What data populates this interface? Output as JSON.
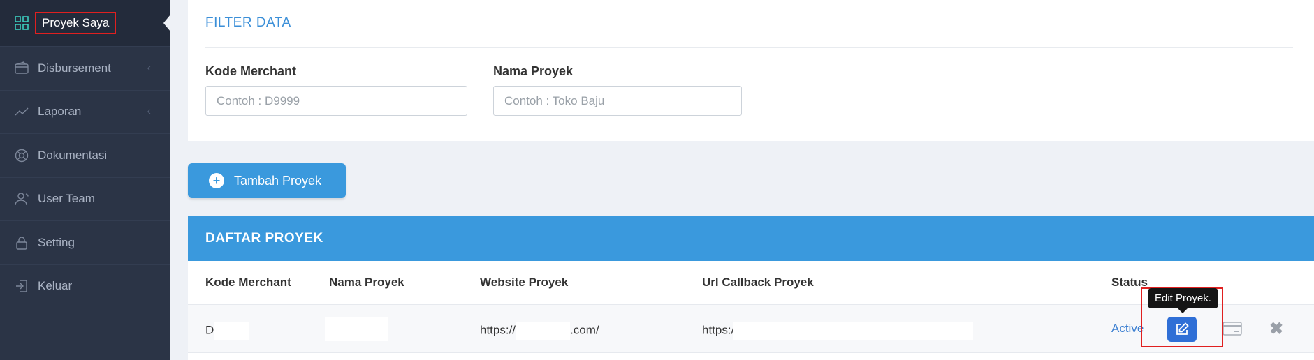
{
  "sidebar": {
    "items": [
      {
        "label": "Proyek Saya",
        "icon": "grid-icon",
        "active": true
      },
      {
        "label": "Disbursement",
        "icon": "wallet-icon",
        "chevron": "‹"
      },
      {
        "label": "Laporan",
        "icon": "chart-line-icon",
        "chevron": "‹"
      },
      {
        "label": "Dokumentasi",
        "icon": "lifebuoy-icon"
      },
      {
        "label": "User Team",
        "icon": "user-icon"
      },
      {
        "label": "Setting",
        "icon": "lock-icon"
      },
      {
        "label": "Keluar",
        "icon": "logout-icon"
      }
    ]
  },
  "filter": {
    "title": "FILTER DATA",
    "kode_merchant_label": "Kode Merchant",
    "kode_merchant_placeholder": "Contoh : D9999",
    "nama_proyek_label": "Nama Proyek",
    "nama_proyek_placeholder": "Contoh : Toko Baju"
  },
  "add_button": {
    "label": "Tambah Proyek"
  },
  "daftar": {
    "title": "DAFTAR PROYEK",
    "columns": [
      "Kode Merchant",
      "Nama Proyek",
      "Website Proyek",
      "Url Callback Proyek",
      "Status"
    ],
    "rows": [
      {
        "kode_prefix": "D",
        "website_prefix": "https://",
        "website_suffix": ".com/",
        "callback_prefix": "https://",
        "status": "Active"
      }
    ]
  },
  "tooltip": {
    "text": "Edit Proyek."
  },
  "colors": {
    "sidebar_bg": "#2b3446",
    "accent": "#3a99dd",
    "edit_button": "#2f6fd6",
    "highlight": "#e02020"
  }
}
